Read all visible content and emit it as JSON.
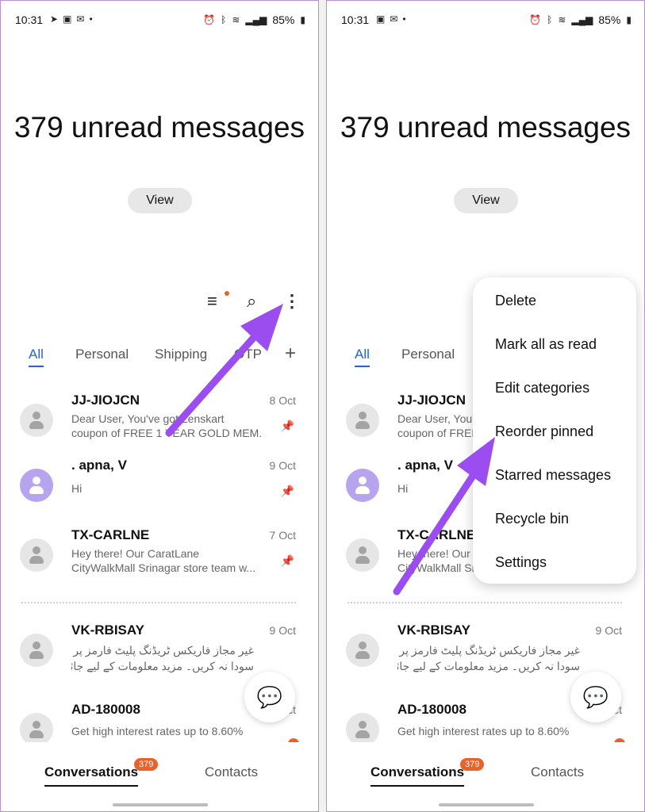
{
  "status": {
    "time": "10:31",
    "battery": "85%"
  },
  "hero": {
    "title": "379 unread messages",
    "view": "View"
  },
  "tabs": [
    "All",
    "Personal",
    "Shipping",
    "OTP"
  ],
  "tab_add": "+",
  "conversations": [
    {
      "name": "JJ-JIOJCN",
      "date": "8 Oct",
      "line1": "Dear User, You've got Lenskart",
      "line2": "coupon of FREE 1 YEAR GOLD MEM...",
      "pinned": true
    },
    {
      "name": ". apna, V",
      "date": "9 Oct",
      "line1": "Hi",
      "line2": "",
      "pinned": true
    },
    {
      "name": "TX-CARLNE",
      "date": "7 Oct",
      "line1": "Hey there! Our CaratLane",
      "line2": "CityWalkMall Srinagar store team w...",
      "pinned": true
    },
    {
      "name": "VK-RBISAY",
      "date": "9 Oct",
      "line1": "غیر مجاز فاریکس ٹریڈنگ پلیٹ فارمز پر",
      "line2": "سودا نہ کریں۔ مزید معلومات کے لیے جائیں:",
      "pinned": false
    },
    {
      "name": "AD-180008",
      "date": "Oct",
      "line1": "Get high interest rates up to 8.60%",
      "line2": "",
      "pinned": false
    }
  ],
  "bottom_nav": {
    "conversations": "Conversations",
    "badge": "379",
    "contacts": "Contacts"
  },
  "menu": [
    "Delete",
    "Mark all as read",
    "Edit categories",
    "Reorder pinned",
    "Starred messages",
    "Recycle bin",
    "Settings"
  ],
  "colors": {
    "accent": "#1f64d8",
    "badge": "#e8632a",
    "arrow": "#9b4df0"
  }
}
